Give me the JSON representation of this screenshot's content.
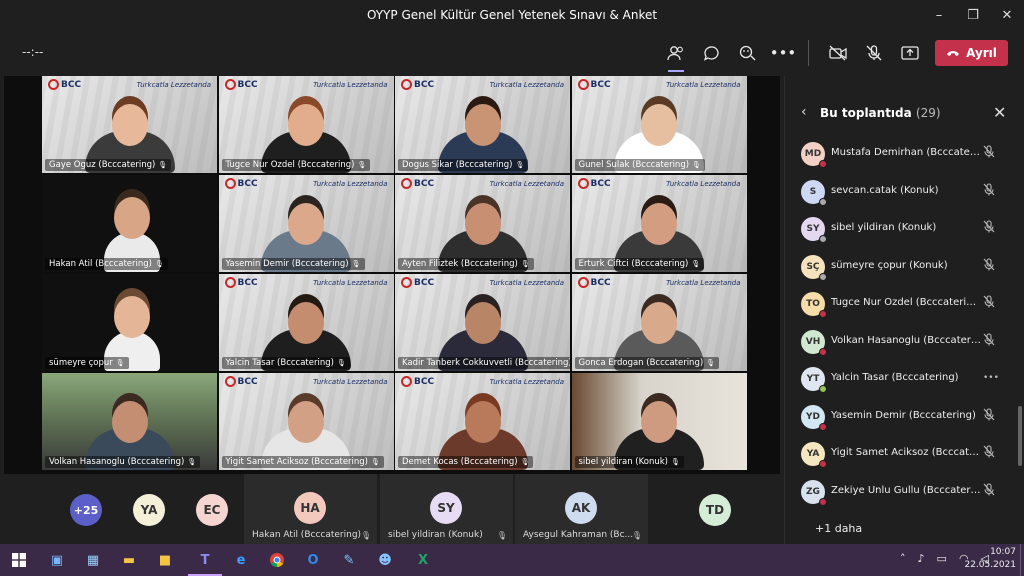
{
  "window": {
    "title": "OYYP Genel Kültür Genel Yetenek Sınavı & Anket",
    "minimize": "–",
    "maximize": "❐",
    "close": "✕"
  },
  "toolbar": {
    "timer": "--:--",
    "leave_label": "Ayrıl",
    "people_icon": "people-icon",
    "chat_icon": "chat-icon",
    "reactions_icon": "reactions-icon",
    "more_icon": "•••",
    "camera_icon": "camera-off-icon",
    "mic_icon": "mic-off-icon",
    "share_icon": "share-icon"
  },
  "colors": {
    "leave": "#c4314b",
    "accent": "#c9a0ff",
    "taskbar": "#3a2a47"
  },
  "tiles": [
    {
      "name": "Gaye Oguz (Bcccatering)"
    },
    {
      "name": "Tugce Nur Ozdel (Bcccatering)"
    },
    {
      "name": "Dogus Sikar (Bcccatering)"
    },
    {
      "name": "Gunel Sulak (Bcccatering)"
    },
    {
      "name": "Hakan Atil (Bcccatering)"
    },
    {
      "name": "Yasemin Demir (Bcccatering)"
    },
    {
      "name": "Ayten Filiztek (Bcccatering)"
    },
    {
      "name": "Erturk Ciftci (Bcccatering)"
    },
    {
      "name": "sümeyre çopur"
    },
    {
      "name": "Yalcin Tasar (Bcccatering)"
    },
    {
      "name": "Kadir Tanberk Cokkuvvetli (Bcccatering)"
    },
    {
      "name": "Gonca Erdogan (Bcccatering)"
    },
    {
      "name": "Volkan Hasanoglu (Bcccatering)"
    },
    {
      "name": "Yigit Samet Aciksoz (Bcccatering)"
    },
    {
      "name": "Demet Kocas (Bcccatering)"
    },
    {
      "name": "sibel yildiran (Konuk)"
    }
  ],
  "tile_branding": {
    "logo": "BCC",
    "logo_sub": "Catering",
    "slogan": "Turkcatla Lezzetanda"
  },
  "strip": {
    "overflow": "+25",
    "avatars": [
      {
        "initials": "YA"
      },
      {
        "initials": "EC"
      },
      {
        "initials": "HA",
        "name": "Hakan Atil (Bcccatering)"
      },
      {
        "initials": "SY",
        "name": "sibel yildiran (Konuk)"
      },
      {
        "initials": "AK",
        "name": "Aysegul Kahraman (Bc..."
      },
      {
        "initials": "TD"
      }
    ]
  },
  "panel": {
    "title": "Bu toplantıda",
    "count": "(29)",
    "more": "+1 daha",
    "participants": [
      {
        "initials": "MD",
        "name": "Mustafa Demirhan (Bcccatering)",
        "color": "#f3d0c4"
      },
      {
        "initials": "S",
        "name": "sevcan.catak (Konuk)",
        "color": "#cdd9f2"
      },
      {
        "initials": "SY",
        "name": "sibel yildiran (Konuk)",
        "color": "#e4d8f0"
      },
      {
        "initials": "SÇ",
        "name": "sümeyre çopur (Konuk)",
        "color": "#f6e2bd"
      },
      {
        "initials": "TO",
        "name": "Tugce Nur Ozdel (Bcccatering)",
        "color": "#f6dca8"
      },
      {
        "initials": "VH",
        "name": "Volkan Hasanoglu (Bcccatering)",
        "color": "#cfe8cf"
      },
      {
        "initials": "YT",
        "name": "Yalcin Tasar (Bcccatering)",
        "color": "#dfe6f2"
      },
      {
        "initials": "YD",
        "name": "Yasemin Demir (Bcccatering)",
        "color": "#d3e7f2"
      },
      {
        "initials": "YA",
        "name": "Yigit Samet Aciksoz (Bcccatering)",
        "color": "#f4e6bf"
      },
      {
        "initials": "ZG",
        "name": "Zekiye Unlu Gullu (Bcccatering)",
        "color": "#d8e2ee"
      }
    ]
  },
  "taskbar": {
    "time": "10:07",
    "date": "22.05.2021"
  }
}
